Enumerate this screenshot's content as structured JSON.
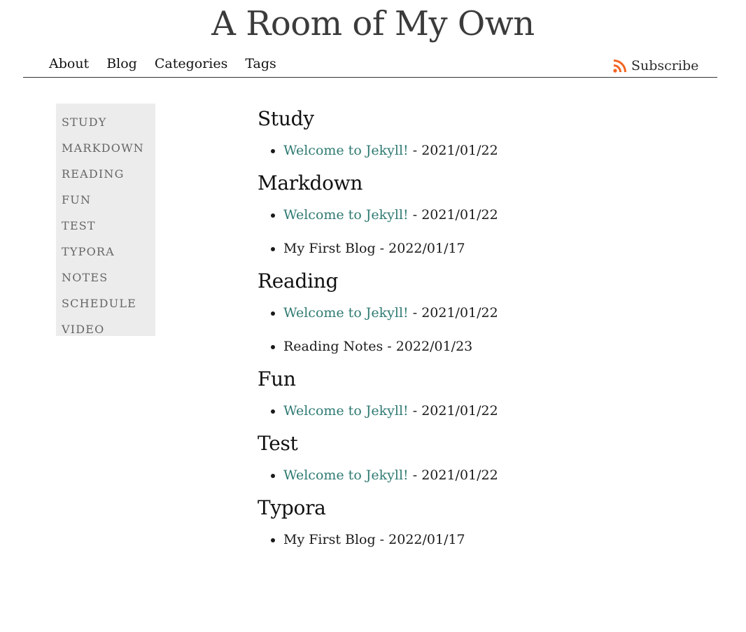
{
  "site": {
    "title": "A Room of My Own"
  },
  "nav": {
    "items": [
      {
        "label": "About"
      },
      {
        "label": "Blog"
      },
      {
        "label": "Categories"
      },
      {
        "label": "Tags"
      }
    ],
    "subscribe_label": "Subscribe",
    "subscribe_icon": "rss-icon",
    "subscribe_icon_color": "#f26522"
  },
  "sidebar": {
    "items": [
      {
        "label": "STUDY"
      },
      {
        "label": "MARKDOWN"
      },
      {
        "label": "READING"
      },
      {
        "label": "FUN"
      },
      {
        "label": "TEST"
      },
      {
        "label": "TYPORA"
      },
      {
        "label": "NOTES"
      },
      {
        "label": "SCHEDULE"
      },
      {
        "label": "VIDEO"
      }
    ]
  },
  "colors": {
    "link": "#2f7a72",
    "sidebar_bg": "#ececec"
  },
  "categories": [
    {
      "name": "Study",
      "posts": [
        {
          "title": "Welcome to Jekyll!",
          "date": " - 2021/01/22",
          "linked": true
        }
      ]
    },
    {
      "name": "Markdown",
      "posts": [
        {
          "title": "Welcome to Jekyll!",
          "date": " - 2021/01/22",
          "linked": true
        },
        {
          "title": "My First Blog",
          "date": " - 2022/01/17",
          "linked": false
        }
      ]
    },
    {
      "name": "Reading",
      "posts": [
        {
          "title": "Welcome to Jekyll!",
          "date": " - 2021/01/22",
          "linked": true
        },
        {
          "title": "Reading Notes",
          "date": " - 2022/01/23",
          "linked": false
        }
      ]
    },
    {
      "name": "Fun",
      "posts": [
        {
          "title": "Welcome to Jekyll!",
          "date": " - 2021/01/22",
          "linked": true
        }
      ]
    },
    {
      "name": "Test",
      "posts": [
        {
          "title": "Welcome to Jekyll!",
          "date": " - 2021/01/22",
          "linked": true
        }
      ]
    },
    {
      "name": "Typora",
      "posts": [
        {
          "title": "My First Blog",
          "date": " - 2022/01/17",
          "linked": false
        }
      ]
    }
  ]
}
